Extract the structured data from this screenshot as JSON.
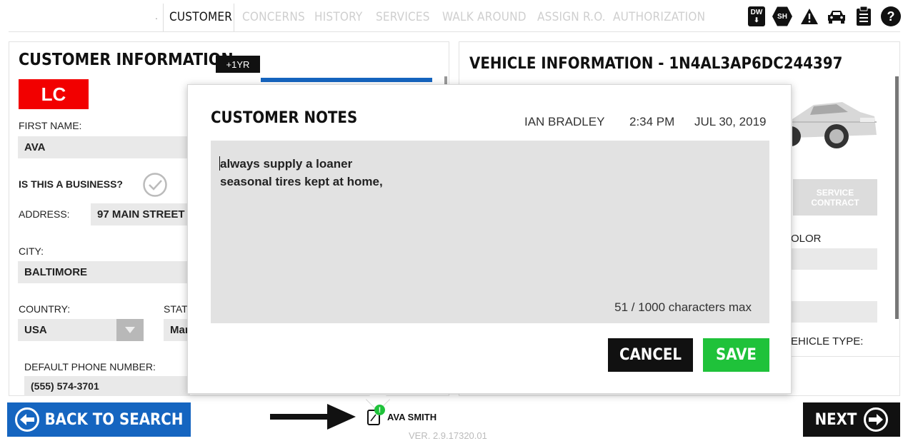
{
  "tabs": [
    {
      "label": "CUSTOMER",
      "active": true
    },
    {
      "label": "CONCERNS",
      "active": false
    },
    {
      "label": "HISTORY",
      "active": false
    },
    {
      "label": "SERVICES",
      "active": false
    },
    {
      "label": "WALK AROUND",
      "active": false
    },
    {
      "label": "ASSIGN R.O.",
      "active": false
    },
    {
      "label": "AUTHORIZATION",
      "active": false
    }
  ],
  "top_icons": {
    "dw": "DW",
    "sh": "SH",
    "warning": "warning-icon",
    "car": "car-icon",
    "clipboard": "clipboard-icon",
    "help": "?"
  },
  "customer": {
    "title": "CUSTOMER INFORMATION",
    "term_badge": "+1YR",
    "initials_badge": "LC",
    "first_name_label": "FIRST NAME:",
    "first_name": "AVA",
    "business_label": "IS THIS A BUSINESS?",
    "address_label": "ADDRESS:",
    "address": "97 MAIN STREET",
    "city_label": "CITY:",
    "city": "BALTIMORE",
    "country_label": "COUNTRY:",
    "country": "USA",
    "state_label": "STAT",
    "state": "Mar",
    "phone_label": "DEFAULT PHONE NUMBER:",
    "phone": "(555) 574-3701"
  },
  "vehicle": {
    "title": "VEHICLE INFORMATION - 1N4AL3AP6DC244397",
    "service_contract": "SERVICE CONTRACT",
    "color_label": "OLOR",
    "vehicle_type_label": "EHICLE TYPE:"
  },
  "notes_modal": {
    "title": "CUSTOMER NOTES",
    "author": "IAN BRADLEY",
    "time": "2:34 PM",
    "date": "JUL 30, 2019",
    "text": "always supply a loaner\nseasonal tires kept at home,",
    "char_count": "51 / 1000 characters max",
    "cancel_label": "CANCEL",
    "save_label": "SAVE"
  },
  "footer": {
    "back_label": "BACK TO SEARCH",
    "next_label": "NEXT",
    "customer_name": "AVA SMITH",
    "notes_badge": "!",
    "version": "VER. 2.9.17320.01"
  },
  "colors": {
    "accent_blue": "#1565c0",
    "save_green": "#1fc23a",
    "badge_red": "#f20000",
    "dark": "#111111"
  }
}
